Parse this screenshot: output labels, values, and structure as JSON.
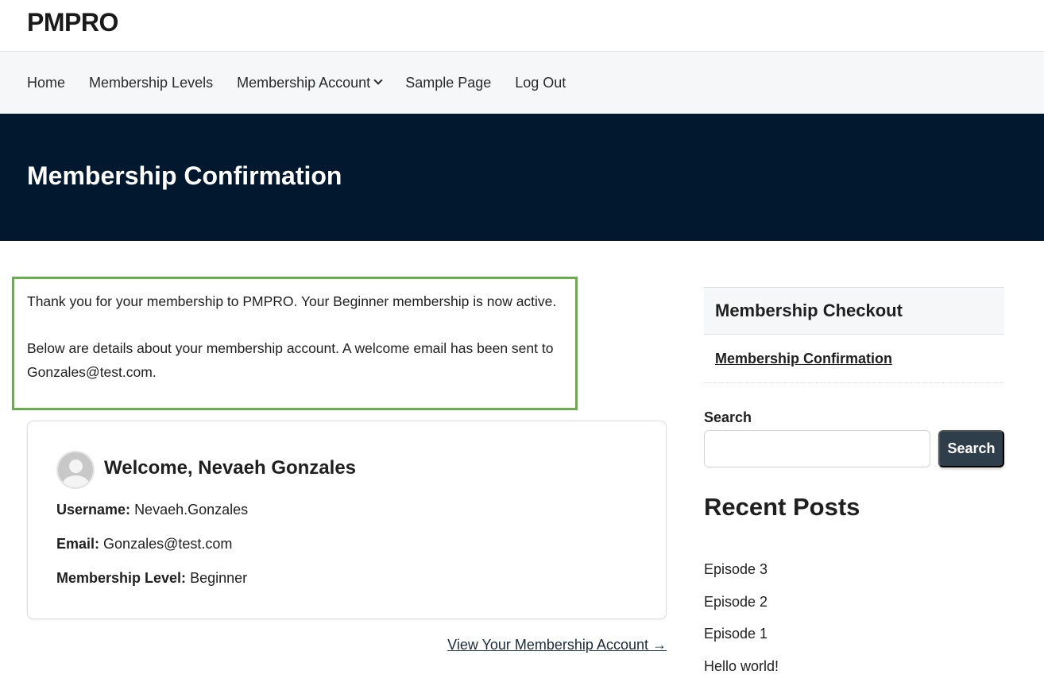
{
  "site": {
    "title": "PMPRO"
  },
  "nav": {
    "items": [
      {
        "label": "Home"
      },
      {
        "label": "Membership Levels"
      },
      {
        "label": "Membership Account",
        "has_dropdown": true
      },
      {
        "label": "Sample Page"
      },
      {
        "label": "Log Out"
      }
    ]
  },
  "hero": {
    "title": "Membership Confirmation"
  },
  "confirmation": {
    "p1": "Thank you for your membership to PMPRO. Your Beginner membership is now active.",
    "p2": "Below are details about your membership account. A welcome email has been sent to Gonzales@test.com."
  },
  "account": {
    "welcome": "Welcome, Nevaeh Gonzales",
    "username_label": "Username:",
    "username": "Nevaeh.Gonzales",
    "email_label": "Email:",
    "email": "Gonzales@test.com",
    "level_label": "Membership Level:",
    "level": "Beginner",
    "view_link": "View Your Membership Account →"
  },
  "sidebar": {
    "nav_title": "Membership Checkout",
    "nav_link": "Membership Confirmation",
    "search_label": "Search",
    "search_value": "",
    "search_button": "Search",
    "recent_title": "Recent Posts",
    "recent_posts": [
      "Episode 3",
      "Episode 2",
      "Episode 1",
      "Hello world!"
    ]
  },
  "colors": {
    "hero_bg": "#02182e",
    "accent_border": "#6aad4b",
    "button_bg": "#2f3e4b"
  }
}
